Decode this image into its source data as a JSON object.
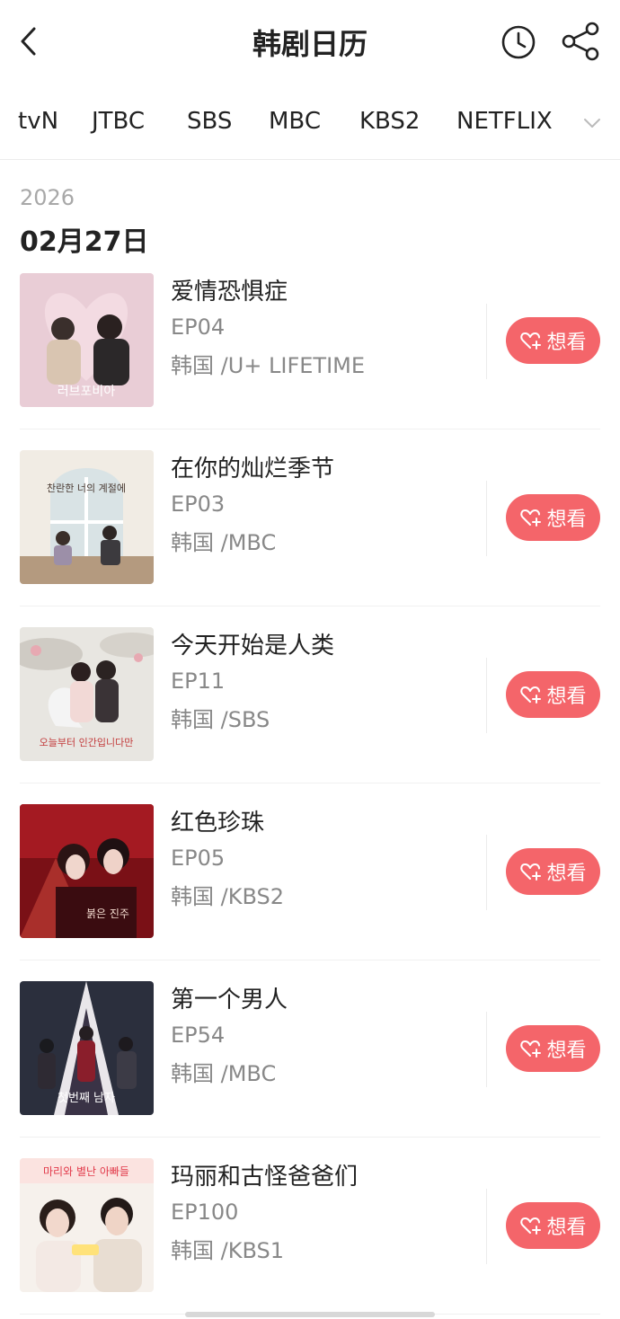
{
  "header": {
    "title": "韩剧日历",
    "back_icon": "back-arrow-icon",
    "history_icon": "clock-icon",
    "share_icon": "share-icon"
  },
  "tabs": [
    "tvN",
    "JTBC",
    "SBS",
    "MBC",
    "KBS2",
    "NETFLIX"
  ],
  "tabs_more_icon": "chevron-down-icon",
  "date_section": {
    "year": "2026",
    "date": "02月27日"
  },
  "want_label": "想看",
  "colors": {
    "accent": "#f4656a",
    "muted_text": "#888888",
    "year_text": "#a8a8a8"
  },
  "shows": [
    {
      "name": "爱情恐惧症",
      "episode": "EP04",
      "meta": "韩国 /U+ LIFETIME",
      "poster_text": "러브포비아"
    },
    {
      "name": "在你的灿烂季节",
      "episode": "EP03",
      "meta": "韩国 /MBC",
      "poster_text": "찬란한 너의 계절에"
    },
    {
      "name": "今天开始是人类",
      "episode": "EP11",
      "meta": "韩国 /SBS",
      "poster_text": "오늘부터 인간입니다만"
    },
    {
      "name": "红色珍珠",
      "episode": "EP05",
      "meta": "韩国 /KBS2",
      "poster_text": "붉은 진주"
    },
    {
      "name": "第一个男人",
      "episode": "EP54",
      "meta": "韩国 /MBC",
      "poster_text": "첫번째 남자"
    },
    {
      "name": "玛丽和古怪爸爸们",
      "episode": "EP100",
      "meta": "韩国 /KBS1",
      "poster_text": "마리와 별난 아빠들"
    }
  ]
}
